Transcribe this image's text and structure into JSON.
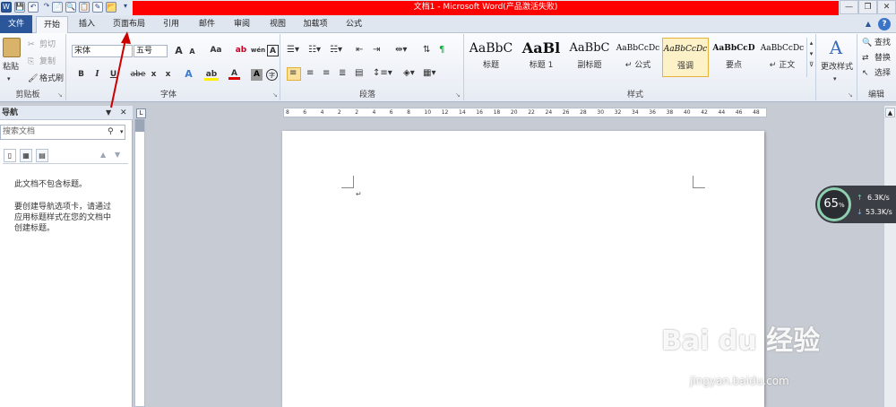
{
  "window": {
    "title": "文档1 - Microsoft Word(产品激活失败)",
    "quick_access": [
      "W",
      "💾",
      "↶",
      "↷",
      "📄",
      "🔍",
      "📋",
      "✎",
      "📂",
      "▾"
    ],
    "controls": {
      "minimize": "—",
      "restore": "❐",
      "close": "✕"
    }
  },
  "tabs": {
    "file": "文件",
    "items": [
      {
        "label": "开始"
      },
      {
        "label": "插入"
      },
      {
        "label": "页面布局"
      },
      {
        "label": "引用"
      },
      {
        "label": "邮件"
      },
      {
        "label": "审阅"
      },
      {
        "label": "视图"
      },
      {
        "label": "加载项"
      },
      {
        "label": "公式"
      }
    ]
  },
  "clipboard": {
    "paste": "粘贴",
    "cut": "剪切",
    "copy": "复制",
    "format_painter": "格式刷",
    "group": "剪贴板"
  },
  "font": {
    "name": "宋体",
    "size": "五号",
    "grow": "A",
    "shrink": "A",
    "case": "Aa",
    "clear": "ab",
    "phonetic": "wén",
    "border": "A",
    "bold": "B",
    "italic": "I",
    "underline": "U",
    "strike": "abe",
    "subscript": "x",
    "superscript": "x",
    "effects": "A",
    "highlight": "ab",
    "color": "A",
    "shading": "A",
    "enclose": "字",
    "group": "字体"
  },
  "paragraph": {
    "group": "段落"
  },
  "styles": {
    "group": "样式",
    "items": [
      {
        "sample": "AaBbC",
        "name": "标题"
      },
      {
        "sample": "AaBl",
        "name": "标题 1"
      },
      {
        "sample": "AaBbC",
        "name": "副标题"
      },
      {
        "sample": "AaBbCcDc",
        "name": "↵ 公式"
      },
      {
        "sample": "AaBbCcDc",
        "name": "强调"
      },
      {
        "sample": "AaBbCcD",
        "name": "要点"
      },
      {
        "sample": "AaBbCcDc",
        "name": "↵ 正文"
      }
    ],
    "change": "更改样式"
  },
  "editing": {
    "find": "查找",
    "replace": "替换",
    "select": "选择",
    "group": "编辑"
  },
  "nav": {
    "title": "导航",
    "search_placeholder": "搜索文档",
    "empty": "此文档不包含标题。",
    "hint": "要创建导航选项卡，请通过应用标题样式在您的文档中创建标题。"
  },
  "ruler": {
    "marks": [
      "8",
      "6",
      "4",
      "2",
      "2",
      "4",
      "6",
      "8",
      "10",
      "12",
      "14",
      "16",
      "18",
      "20",
      "22",
      "24",
      "26",
      "28",
      "30",
      "32",
      "34",
      "36",
      "38",
      "40",
      "42",
      "44",
      "46",
      "48"
    ]
  },
  "speed": {
    "percent": "65",
    "unit": "%",
    "up": "6.3K/s",
    "down": "53.3K/s"
  },
  "watermark": {
    "brand": "Bai du 经验",
    "url": "jingyan.baidu.com"
  },
  "colors": {
    "accent": "#2b579a",
    "title_bar": "#ff0000",
    "arrow": "#cc0000",
    "widget": "#8fd0b0"
  }
}
